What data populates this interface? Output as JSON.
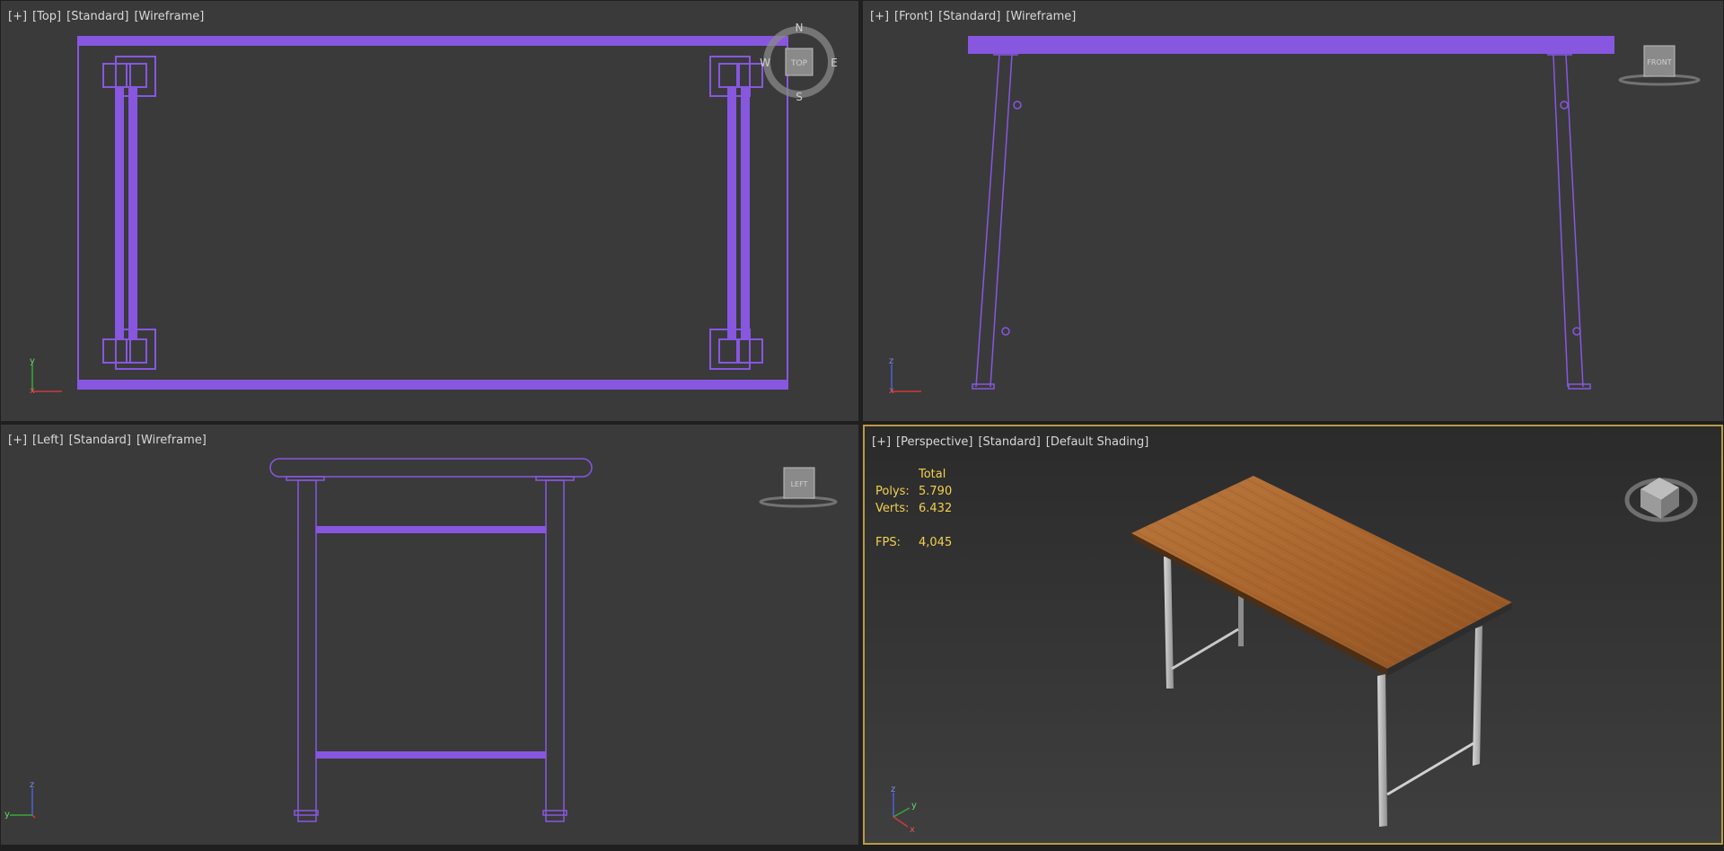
{
  "viewports": {
    "top": {
      "label": {
        "plus": "[+]",
        "view": "[Top]",
        "quality": "[Standard]",
        "shading": "[Wireframe]"
      },
      "compass": {
        "n": "N",
        "s": "S",
        "e": "E",
        "w": "W",
        "cube": "TOP"
      },
      "axes": {
        "a": "y",
        "b": "x"
      }
    },
    "front": {
      "label": {
        "plus": "[+]",
        "view": "[Front]",
        "quality": "[Standard]",
        "shading": "[Wireframe]"
      },
      "cube": "FRONT",
      "axes": {
        "a": "z",
        "b": "x"
      }
    },
    "left": {
      "label": {
        "plus": "[+]",
        "view": "[Left]",
        "quality": "[Standard]",
        "shading": "[Wireframe]"
      },
      "cube": "LEFT",
      "axes": {
        "a": "z",
        "b": "y"
      }
    },
    "perspective": {
      "label": {
        "plus": "[+]",
        "view": "[Perspective]",
        "quality": "[Standard]",
        "shading": "[Default Shading]"
      },
      "stats": {
        "header": "Total",
        "polys_label": "Polys:",
        "polys": "5.790",
        "verts_label": "Verts:",
        "verts": "6.432",
        "fps_label": "FPS:",
        "fps": "4,045"
      },
      "axes": {
        "a": "z",
        "b": "y",
        "c": "x"
      }
    }
  },
  "colors": {
    "wire": "#8757e0",
    "active_border": "#b89a47",
    "stats_text": "#f2d050",
    "wood": "#a8642c"
  }
}
